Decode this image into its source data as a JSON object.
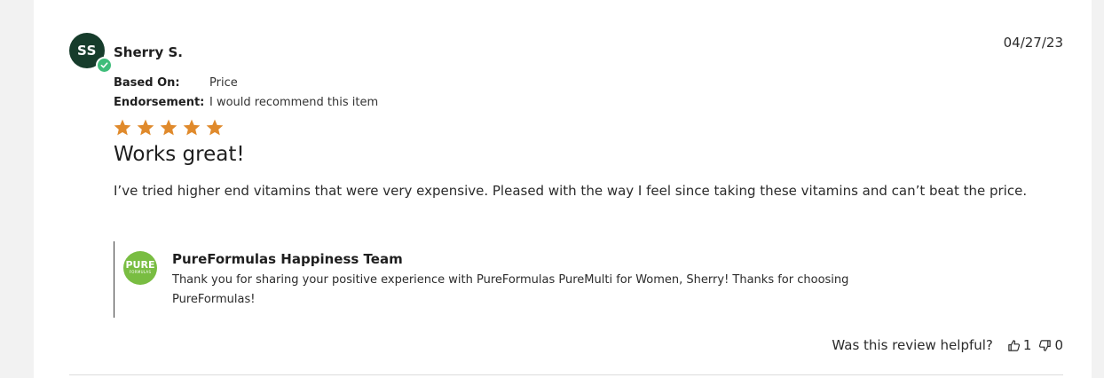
{
  "review": {
    "avatar_initials": "SS",
    "reviewer_name": "Sherry S.",
    "date": "04/27/23",
    "based_on_label": "Based On:",
    "based_on_value": "Price",
    "endorsement_label": "Endorsement:",
    "endorsement_value": "I would recommend this item",
    "rating": 5,
    "rating_max": 5,
    "star_color": "#e08a2c",
    "title": "Works great!",
    "body": "I’ve tried higher end vitamins that were very expensive. Pleased with the way I feel since taking these vitamins and can’t beat the price."
  },
  "reply": {
    "logo_big": "PURE",
    "logo_small": "FORMULAS",
    "name": "PureFormulas Happiness Team",
    "text_line1": "Thank you for sharing your positive experience with PureFormulas PureMulti for Women, Sherry! Thanks for choosing",
    "text_line2": "PureFormulas!"
  },
  "helpful": {
    "question": "Was this review helpful?",
    "up_count": "1",
    "down_count": "0"
  },
  "colors": {
    "avatar_bg": "#163c2b",
    "verified_badge": "#3fbd7a",
    "brand_green": "#79bd42"
  }
}
